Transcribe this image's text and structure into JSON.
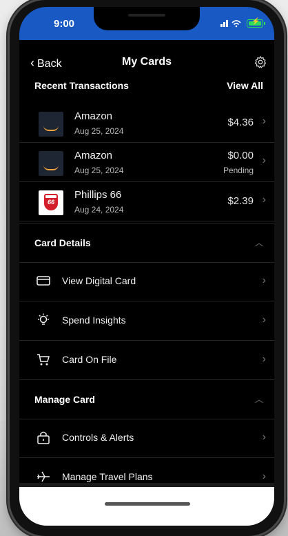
{
  "status_bar": {
    "time": "9:00"
  },
  "nav": {
    "back_label": "Back",
    "title": "My Cards"
  },
  "recent_transactions": {
    "heading": "Recent Transactions",
    "view_all": "View All",
    "items": [
      {
        "merchant": "Amazon",
        "date": "Aug 25, 2024",
        "amount": "$4.36",
        "status": "",
        "logo": "amazon-logo"
      },
      {
        "merchant": "Amazon",
        "date": "Aug 25, 2024",
        "amount": "$0.00",
        "status": "Pending",
        "logo": "amazon-logo"
      },
      {
        "merchant": "Phillips 66",
        "date": "Aug 24, 2024",
        "amount": "$2.39",
        "status": "",
        "logo": "phillips66-logo",
        "logo_text": "66"
      }
    ]
  },
  "card_details": {
    "heading": "Card Details",
    "items": [
      {
        "label": "View Digital Card",
        "icon": "card-icon"
      },
      {
        "label": "Spend Insights",
        "icon": "lightbulb-icon"
      },
      {
        "label": "Card On File",
        "icon": "cart-icon"
      }
    ]
  },
  "manage_card": {
    "heading": "Manage Card",
    "items": [
      {
        "label": "Controls & Alerts",
        "icon": "lock-icon"
      },
      {
        "label": "Manage Travel Plans",
        "icon": "airplane-icon"
      }
    ]
  },
  "colors": {
    "status_bar": "#1859c4",
    "background": "#000000",
    "battery": "#2fdc5a"
  }
}
